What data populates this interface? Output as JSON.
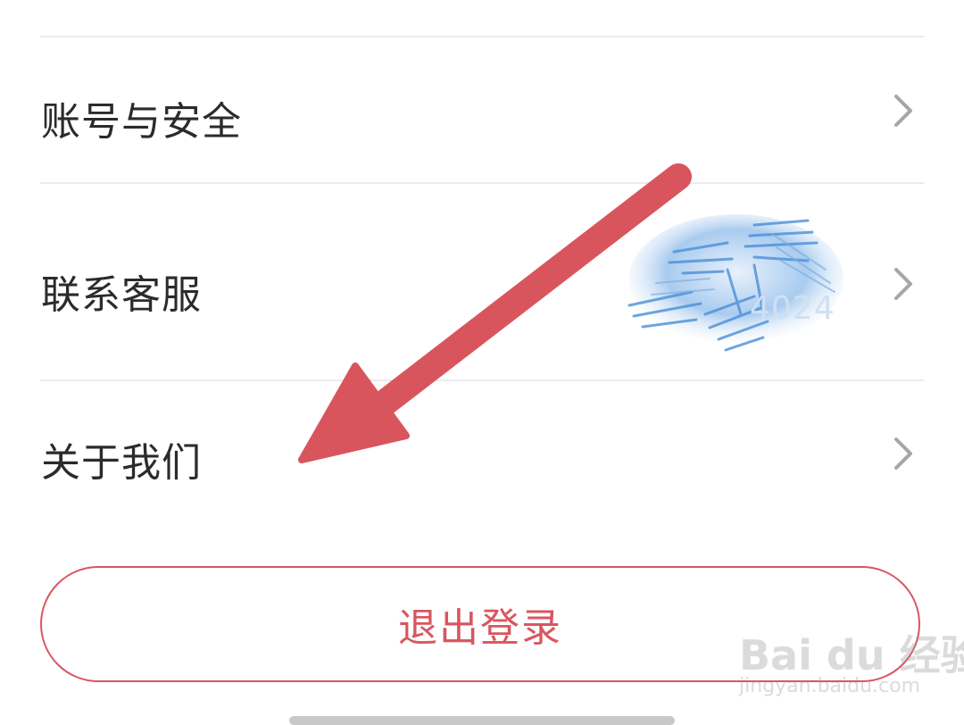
{
  "settings": {
    "items": [
      {
        "label": "账号与安全",
        "icon": "chevron-right-icon"
      },
      {
        "label": "联系客服",
        "icon": "chevron-right-icon",
        "redacted_value": "4024"
      },
      {
        "label": "关于我们",
        "icon": "chevron-right-icon"
      }
    ]
  },
  "logout": {
    "label": "退出登录"
  },
  "watermark": {
    "brand": "Bai du 经验",
    "url": "jingyan.baidu.com"
  },
  "colors": {
    "text": "#2b2b2b",
    "divider": "#ebebeb",
    "chevron": "#a6a6a6",
    "accent": "#d9565f",
    "annotation_arrow": "#d9555d",
    "scribble": "#4a8fd9"
  }
}
